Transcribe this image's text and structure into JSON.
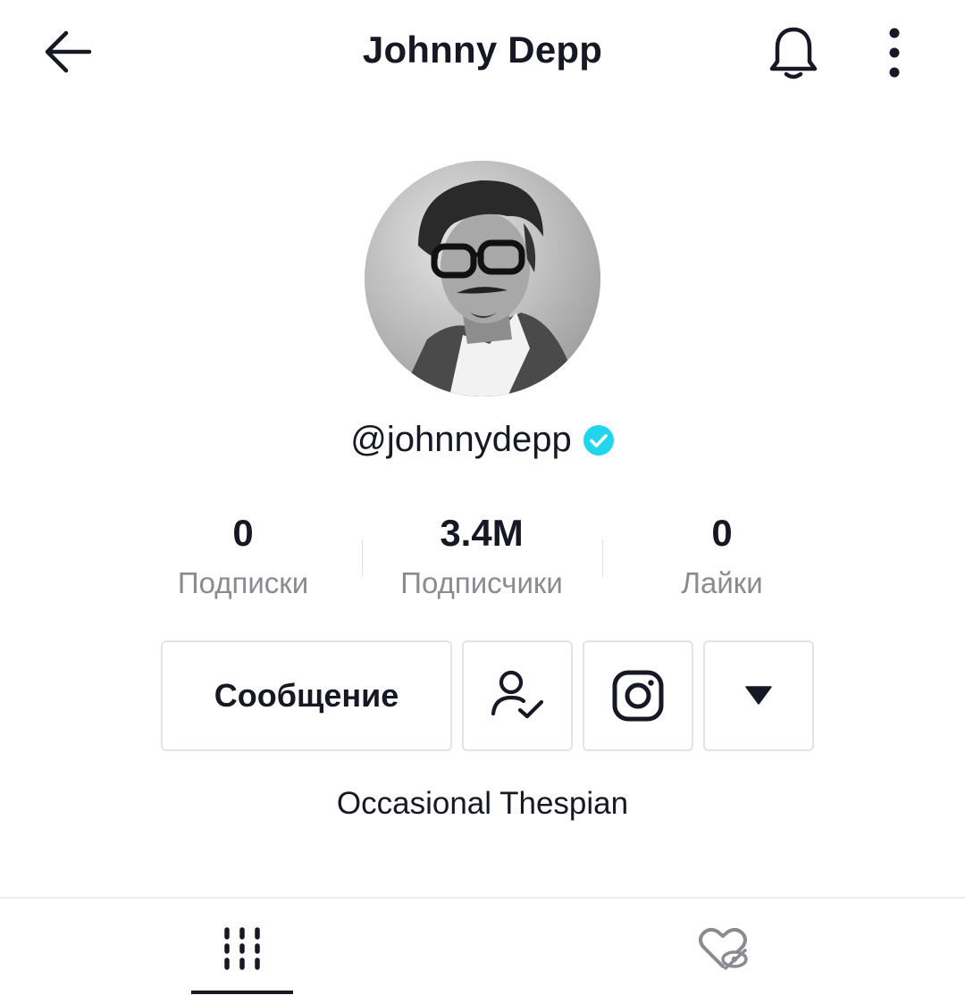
{
  "header": {
    "title": "Johnny Depp",
    "icons": {
      "back": "arrow-left-icon",
      "bell": "bell-icon",
      "more": "vertical-dots-icon"
    }
  },
  "profile": {
    "username": "@johnnydepp",
    "verified": true,
    "verified_color": "#20d5ec",
    "bio": "Occasional Thespian"
  },
  "stats": [
    {
      "value": "0",
      "label": "Подписки"
    },
    {
      "value": "3.4M",
      "label": "Подписчики"
    },
    {
      "value": "0",
      "label": "Лайки"
    }
  ],
  "actions": {
    "message_label": "Сообщение",
    "icons": {
      "following": "person-check-icon",
      "instagram": "instagram-icon",
      "more": "triangle-down-icon"
    }
  },
  "tabs": [
    {
      "icon": "grid-videos-icon",
      "active": true
    },
    {
      "icon": "hidden-liked-icon",
      "active": false
    }
  ],
  "colors": {
    "text": "#161823",
    "secondary": "#8a8b91",
    "border": "#e3e3e4"
  }
}
